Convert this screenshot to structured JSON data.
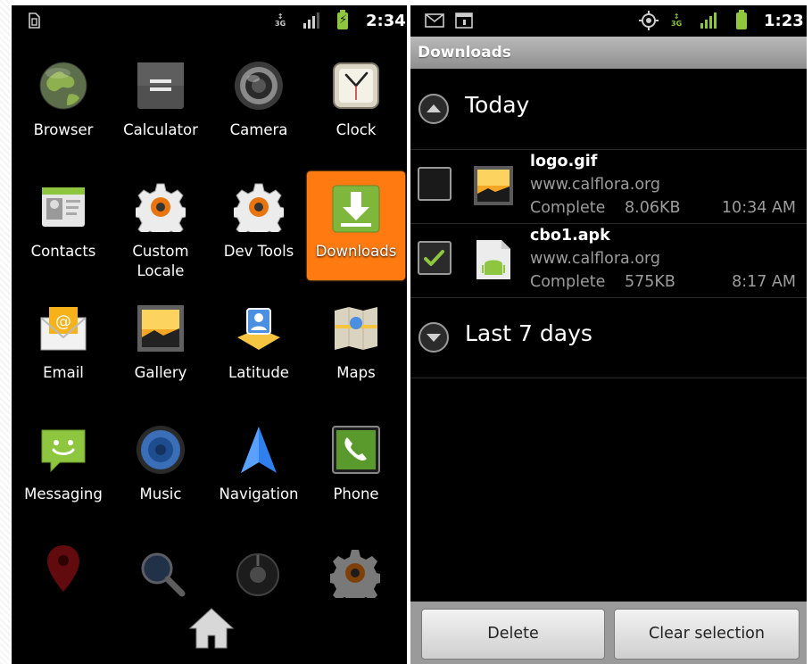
{
  "left_screen": {
    "status": {
      "time": "2:34",
      "network": "3G",
      "left_icon": "sim-card-icon",
      "signal": "signal-bars-icon",
      "battery": "battery-charging-icon"
    },
    "apps": [
      {
        "label": "Browser",
        "icon": "globe-icon"
      },
      {
        "label": "Calculator",
        "icon": "calculator-icon"
      },
      {
        "label": "Camera",
        "icon": "camera-icon"
      },
      {
        "label": "Clock",
        "icon": "clock-icon"
      },
      {
        "label": "Contacts",
        "icon": "contacts-icon"
      },
      {
        "label": "Custom Locale",
        "icon": "gear-icon"
      },
      {
        "label": "Dev Tools",
        "icon": "gear-icon"
      },
      {
        "label": "Downloads",
        "icon": "download-icon",
        "selected": true
      },
      {
        "label": "Email",
        "icon": "email-icon"
      },
      {
        "label": "Gallery",
        "icon": "gallery-icon"
      },
      {
        "label": "Latitude",
        "icon": "latitude-icon"
      },
      {
        "label": "Maps",
        "icon": "maps-icon"
      },
      {
        "label": "Messaging",
        "icon": "messaging-icon"
      },
      {
        "label": "Music",
        "icon": "speaker-icon"
      },
      {
        "label": "Navigation",
        "icon": "navigation-arrow-icon"
      },
      {
        "label": "Phone",
        "icon": "phone-icon"
      }
    ],
    "selected_color": "#ff7a10"
  },
  "right_screen": {
    "status": {
      "time": "1:23",
      "network": "3G"
    },
    "title": "Downloads",
    "groups": [
      {
        "label": "Today",
        "expanded": true
      },
      {
        "label": "Last 7 days",
        "expanded": false
      }
    ],
    "items": [
      {
        "name": "logo.gif",
        "host": "www.calflora.org",
        "status": "Complete",
        "size": "8.06KB",
        "time": "10:34 AM",
        "checked": false
      },
      {
        "name": "cbo1.apk",
        "host": "www.calflora.org",
        "status": "Complete",
        "size": "575KB",
        "time": "8:17 AM",
        "checked": true
      }
    ],
    "buttons": {
      "delete": "Delete",
      "clear": "Clear selection"
    },
    "check_color": "#8ec63f"
  }
}
